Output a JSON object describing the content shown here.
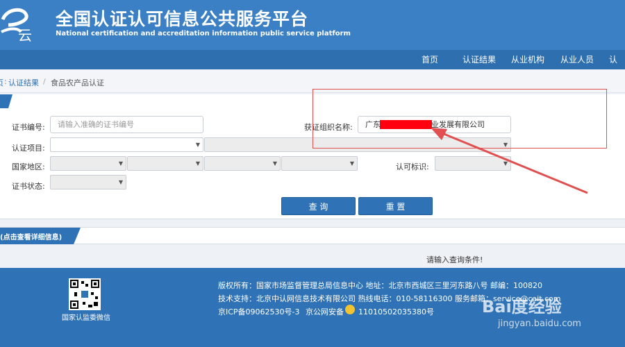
{
  "header": {
    "logo_text": "云",
    "title": "全国认证认可信息公共服务平台",
    "subtitle": "National certification and accreditation information public service platform"
  },
  "nav": {
    "items": [
      "首页",
      "认证结果",
      "从业机构",
      "从业人员",
      "认"
    ]
  },
  "breadcrumb": {
    "prefix": "页",
    "link": "认证结果",
    "sep": "/",
    "current": "食品农产品认证"
  },
  "form": {
    "cert_no_label": "证书编号:",
    "cert_no_placeholder": "请输入准确的证书编号",
    "org_label": "获证组织名称:",
    "org_value_left": "广东省",
    "org_value_right": "业发展有限公司",
    "project_label": "认证项目:",
    "region_label": "国家地区:",
    "mark_label": "认可标识:",
    "status_label": "证书状态:",
    "search_button": "查 询",
    "reset_button": "重 置"
  },
  "info_tab": "(点击查看详细信息)",
  "result_message": "请输入查询条件!",
  "footer": {
    "qr_label": "国家认监委微信",
    "line1": "版权所有：国家市场监督管理总局信息中心    地址：北京市西城区三里河东路八号    邮编：100820",
    "line2": "技术支持：北京中认网信息技术有限公司    热线电话：010-58116300    服务邮箱：service@cait.com",
    "line3_icp": "京ICP备09062530号-3",
    "line3_police": "京公网安备",
    "line3_police_no": "11010502035380号"
  },
  "watermark": {
    "brand": "Bai度经验",
    "url": "jingyan.baidu.com"
  },
  "colors": {
    "header_blue": "#3b7fc4",
    "nav_blue": "#2e6fb0",
    "annotation_red": "#e05050",
    "redaction_red": "#ff0010"
  }
}
